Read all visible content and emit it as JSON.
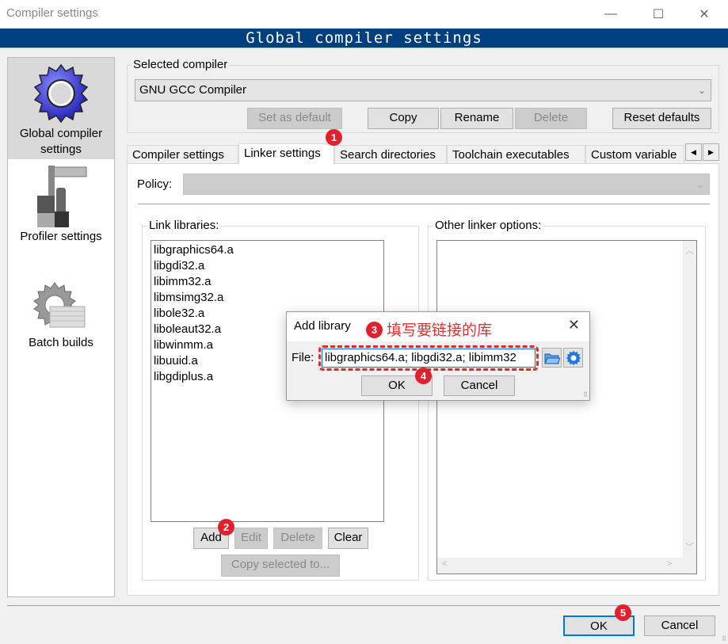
{
  "window": {
    "title": "Compiler settings",
    "minimize_icon": "minimize-icon",
    "maximize_icon": "maximize-icon",
    "close_icon": "close-icon"
  },
  "banner": {
    "title": "Global compiler settings"
  },
  "sidebar": {
    "items": [
      {
        "label": "Global compiler settings",
        "icon": "blue-gear-icon",
        "active": true
      },
      {
        "label": "Profiler settings",
        "icon": "caliper-icon",
        "active": false
      },
      {
        "label": "Batch builds",
        "icon": "gear-stack-icon",
        "active": false
      }
    ]
  },
  "selected_compiler": {
    "group_label": "Selected compiler",
    "value": "GNU GCC Compiler",
    "buttons": {
      "set_default": "Set as default",
      "copy": "Copy",
      "rename": "Rename",
      "delete": "Delete",
      "reset": "Reset defaults"
    }
  },
  "tabs": [
    {
      "label": "Compiler settings",
      "active": false
    },
    {
      "label": "Linker settings",
      "active": true
    },
    {
      "label": "Search directories",
      "active": false
    },
    {
      "label": "Toolchain executables",
      "active": false
    },
    {
      "label": "Custom variable",
      "active": false
    }
  ],
  "tab_scroll": {
    "left": "◀",
    "right": "▶"
  },
  "linker": {
    "policy_label": "Policy:",
    "policy_value": "",
    "link_libraries_label": "Link libraries:",
    "libraries": [
      "libgraphics64.a",
      "libgdi32.a",
      "libimm32.a",
      "libmsimg32.a",
      "libole32.a",
      "liboleaut32.a",
      "libwinmm.a",
      "libuuid.a",
      "libgdiplus.a"
    ],
    "buttons": {
      "add": "Add",
      "edit": "Edit",
      "delete": "Delete",
      "clear": "Clear",
      "copy_selected": "Copy selected to..."
    },
    "other_options_label": "Other linker options:",
    "other_options_value": ""
  },
  "dialog": {
    "title": "Add library",
    "file_label": "File:",
    "file_value": "libgraphics64.a; libgdi32.a; libimm32",
    "ok": "OK",
    "cancel": "Cancel"
  },
  "annotations": {
    "badges": [
      "1",
      "2",
      "3",
      "4",
      "5"
    ],
    "note_3": "填写要链接的库",
    "color": "#e0202a"
  },
  "footer": {
    "ok": "OK",
    "cancel": "Cancel"
  }
}
